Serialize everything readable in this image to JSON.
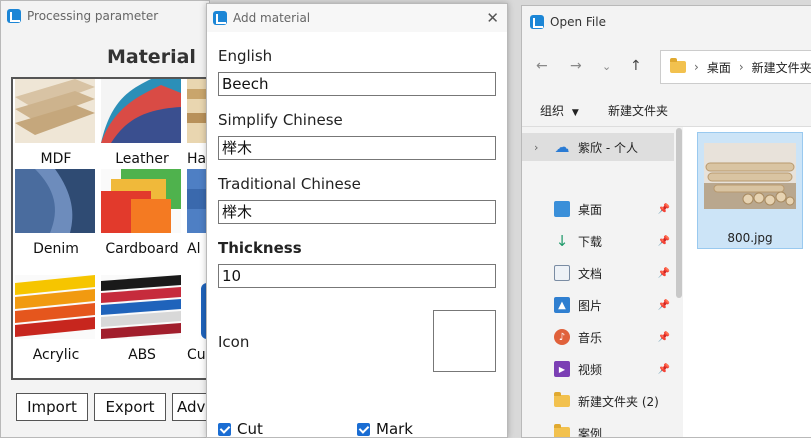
{
  "window1": {
    "title": "Processing parameter",
    "heading": "Material",
    "tiles": [
      {
        "label": "MDF",
        "color": "#d8c3a4"
      },
      {
        "label": "Leather",
        "color": "#d94b45"
      },
      {
        "label": "Ha",
        "color": "#c9a56c"
      },
      {
        "label": "Denim",
        "color": "#3b5f8e"
      },
      {
        "label": "Cardboard",
        "color": "#f0b93a"
      },
      {
        "label": "Al",
        "color": "#4e7fc4"
      },
      {
        "label": "Acrylic",
        "color": "#e5561d"
      },
      {
        "label": "ABS",
        "color": "#c62b3c"
      },
      {
        "label": "Cu",
        "color": "#1f63bb"
      }
    ],
    "buttons": {
      "import": "Import",
      "export": "Export",
      "adv": "Adva"
    }
  },
  "window2": {
    "title": "Add material",
    "english_label": "English",
    "english_value": "Beech",
    "simplified_label": "Simplify Chinese",
    "simplified_value": "榉木",
    "traditional_label": "Traditional Chinese",
    "traditional_value": "榉木",
    "thickness_label": "Thickness",
    "thickness_value": "10",
    "icon_label": "Icon",
    "cut_label": "Cut",
    "mark_label": "Mark",
    "cut_checked": true,
    "mark_checked": true
  },
  "window3": {
    "title": "Open File",
    "breadcrumb": [
      "桌面",
      "新建文件夹"
    ],
    "organize": "组织",
    "new_folder": "新建文件夹",
    "nav_items": [
      {
        "label": "紫欣 - 个人",
        "icon": "cloud-icon"
      },
      {
        "label": "桌面",
        "icon": "desktop-icon",
        "pinned": true
      },
      {
        "label": "下载",
        "icon": "download-icon",
        "pinned": true
      },
      {
        "label": "文档",
        "icon": "document-icon",
        "pinned": true
      },
      {
        "label": "图片",
        "icon": "picture-icon",
        "pinned": true
      },
      {
        "label": "音乐",
        "icon": "music-icon",
        "pinned": true
      },
      {
        "label": "视频",
        "icon": "video-icon",
        "pinned": true
      },
      {
        "label": "新建文件夹 (2)",
        "icon": "folder-icon"
      },
      {
        "label": "案例",
        "icon": "folder-icon"
      }
    ],
    "file": {
      "name": "800.jpg"
    }
  }
}
